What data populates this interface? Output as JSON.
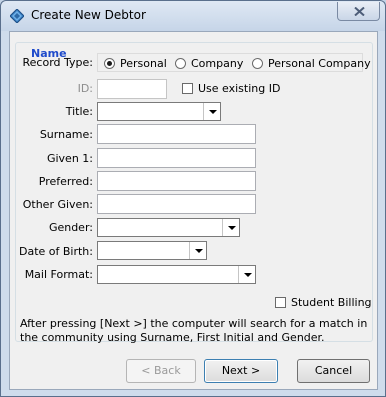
{
  "window": {
    "title": "Create New Debtor",
    "icon": "diamond-app-icon"
  },
  "group": {
    "label": "Name"
  },
  "record_type": {
    "label": "Record Type:",
    "options": [
      "Personal",
      "Company",
      "Personal Company"
    ],
    "selected": "Personal"
  },
  "id_field": {
    "label": "ID:",
    "value": ""
  },
  "use_existing_id": {
    "label": "Use existing ID",
    "checked": false
  },
  "fields": {
    "title": {
      "label": "Title:",
      "value": ""
    },
    "surname": {
      "label": "Surname:",
      "value": ""
    },
    "given1": {
      "label": "Given 1:",
      "value": ""
    },
    "preferred": {
      "label": "Preferred:",
      "value": ""
    },
    "other_given": {
      "label": "Other Given:",
      "value": ""
    },
    "gender": {
      "label": "Gender:",
      "value": ""
    },
    "dob": {
      "label": "Date of Birth:",
      "value": ""
    },
    "mail_format": {
      "label": "Mail Format:",
      "value": ""
    }
  },
  "student_billing": {
    "label": "Student Billing",
    "checked": false
  },
  "info": {
    "text": "After pressing [Next >] the computer will search for a match in the community using Surname, First Initial and Gender."
  },
  "buttons": {
    "back": "< Back",
    "next": "Next >",
    "cancel": "Cancel"
  },
  "colors": {
    "group_label": "#1f4bcb",
    "title_bar": "#c6d5e8"
  }
}
